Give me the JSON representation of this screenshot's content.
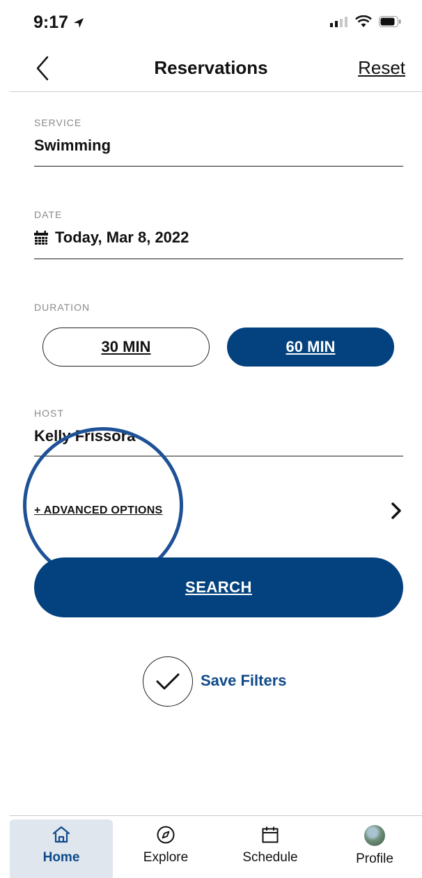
{
  "status_bar": {
    "time": "9:17"
  },
  "header": {
    "title": "Reservations",
    "reset_label": "Reset"
  },
  "form": {
    "service": {
      "label": "SERVICE",
      "value": "Swimming"
    },
    "date": {
      "label": "DATE",
      "value": "Today, Mar 8, 2022"
    },
    "duration": {
      "label": "DURATION",
      "options": [
        "30 MIN",
        "60 MIN"
      ],
      "selected": "60 MIN"
    },
    "host": {
      "label": "HOST",
      "value": "Kelly Frissora"
    }
  },
  "advanced_options_label": "+ ADVANCED OPTIONS",
  "search_label": "SEARCH",
  "save_filters_label": "Save Filters",
  "nav": {
    "items": [
      {
        "label": "Home",
        "icon": "home-icon",
        "active": true
      },
      {
        "label": "Explore",
        "icon": "compass-icon",
        "active": false
      },
      {
        "label": "Schedule",
        "icon": "calendar-icon",
        "active": false
      },
      {
        "label": "Profile",
        "icon": "avatar",
        "active": false
      }
    ]
  },
  "colors": {
    "primary": "#03427e",
    "accent_text": "#0f4a8a",
    "highlight_ring": "#1e5196"
  }
}
